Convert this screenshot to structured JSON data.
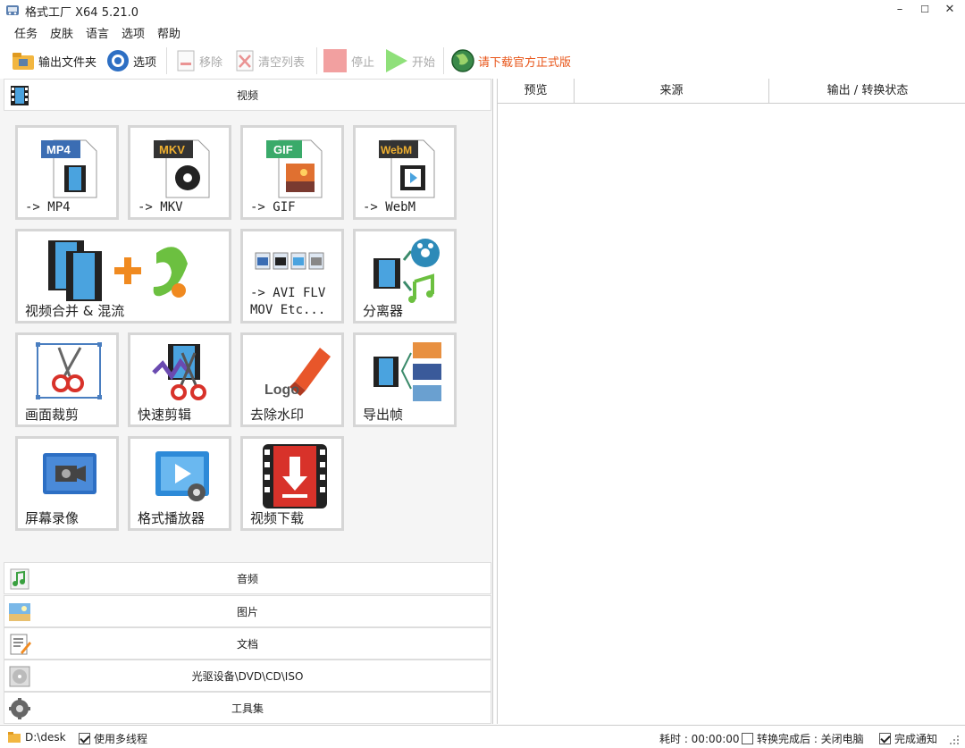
{
  "window": {
    "title": "格式工厂 X64 5.21.0",
    "min": "–",
    "max": "☐",
    "close": "✕"
  },
  "menu": [
    "任务",
    "皮肤",
    "语言",
    "选项",
    "帮助"
  ],
  "toolbar": {
    "output_folder": "输出文件夹",
    "options": "选项",
    "remove": "移除",
    "clear_list": "清空列表",
    "stop": "停止",
    "start": "开始",
    "download_official": "请下载官方正式版"
  },
  "categories": {
    "video": "视频",
    "audio": "音频",
    "image": "图片",
    "document": "文档",
    "optical": "光驱设备\\DVD\\CD\\ISO",
    "tools": "工具集"
  },
  "tiles": [
    {
      "label": "-> MP4",
      "badge": "MP4"
    },
    {
      "label": "-> MKV",
      "badge": "MKV"
    },
    {
      "label": "-> GIF",
      "badge": "GIF"
    },
    {
      "label": "-> WebM",
      "badge": "WebM"
    },
    {
      "label": "视频合并 & 混流"
    },
    {
      "label": "-> AVI FLV\nMOV Etc..."
    },
    {
      "label": "分离器"
    },
    {
      "label": "画面裁剪"
    },
    {
      "label": "快速剪辑"
    },
    {
      "label": "去除水印",
      "logo_text": "Logo"
    },
    {
      "label": "导出帧"
    },
    {
      "label": "屏幕录像"
    },
    {
      "label": "格式播放器"
    },
    {
      "label": "视频下载"
    }
  ],
  "columns": {
    "preview": "预览",
    "source": "来源",
    "output": "输出 / 转换状态"
  },
  "status": {
    "path": "D:\\desk",
    "multithread": "使用多线程",
    "elapsed": "耗时 : 00:00:00",
    "after_convert": "转换完成后 : 关闭电脑",
    "notify": "完成通知"
  },
  "colors": {
    "accent_orange": "#e8561a",
    "panel_bg": "#f5f5f5",
    "tile_border": "#d6d6d6"
  }
}
